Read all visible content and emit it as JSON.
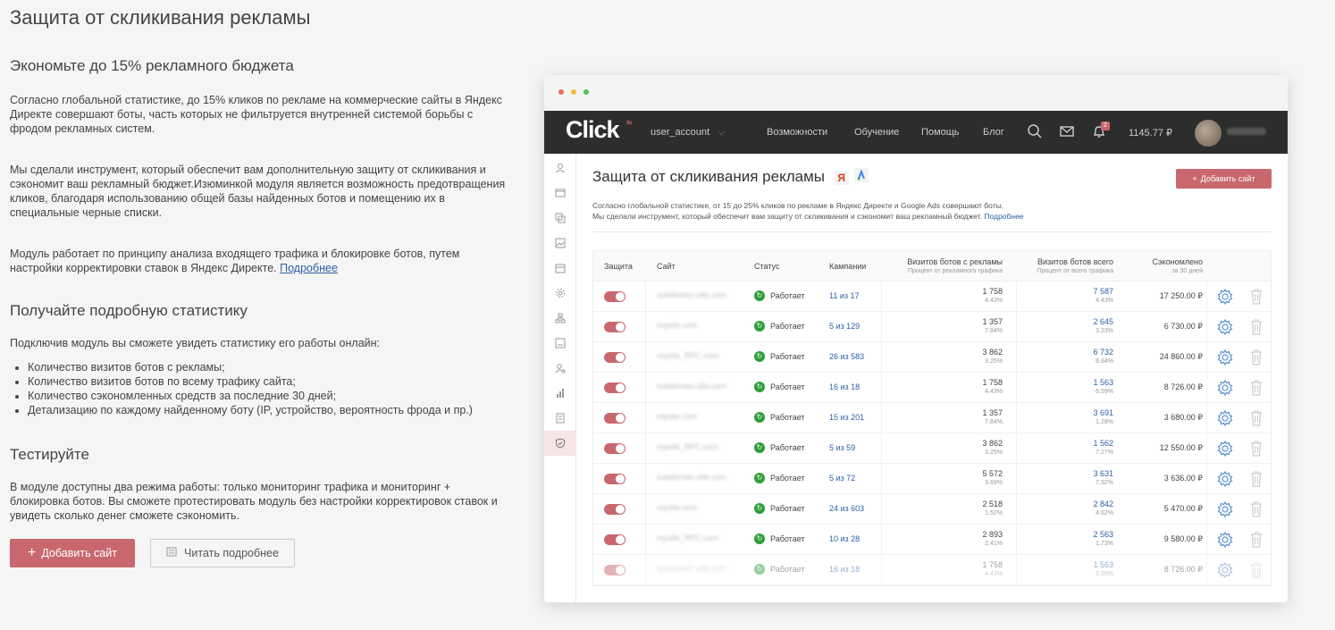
{
  "page": {
    "title": "Защита от скликивания рекламы"
  },
  "section1": {
    "heading": "Экономьте до 15% рекламного бюджета",
    "p1": "Согласно глобальной статистике, до 15% кликов по рекламе на коммерческие сайты в Яндекс Директе совершают боты, часть которых не фильтруется внутренней системой борьбы с фродом рекламных систем.",
    "p2": "Мы сделали инструмент, который обеспечит вам дополнительную защиту от скликивания и сэкономит ваш рекламный бюджет.Изюминкой модуля является возможность предотвращения кликов, благодаря использованию общей базы найденных ботов и помещению их в специальные черные списки.",
    "p3": "Модуль работает по принципу анализа входящего трафика и блокировке ботов, путем настройки корректировки ставок в Яндекс Директе.",
    "p3_link": "Подробнее"
  },
  "section2": {
    "heading": "Получайте подробную статистику",
    "intro": "Подключив модуль вы сможете увидеть статистику его работы онлайн:",
    "items": [
      "Количество визитов ботов с рекламы;",
      "Количество визитов ботов по всему трафику сайта;",
      "Количество сэкономленных средств за последние 30 дней;",
      "Детализацию по каждому найденному боту (IP, устройство, вероятность фрода и пр.)"
    ]
  },
  "section3": {
    "heading": "Тестируйте",
    "text": "В модуле доступны два режима работы: только мониторинг трафика и мониторинг + блокировка ботов. Вы сможете протестировать модуль без настройки корректировок ставок и увидеть сколько денег сможете сэкономить."
  },
  "buttons": {
    "add_site": "Добавить сайт",
    "read_more": "Читать подробнее"
  },
  "mock": {
    "logo": "Click",
    "logo_sup": "ru",
    "account": "user_account",
    "nav": [
      "Возможности",
      "Обучение",
      "Помощь",
      "Блог"
    ],
    "notif_count": "2",
    "balance": "1145.77 ₽",
    "title": "Защита от скликивания рекламы",
    "yandex_badge": "Я",
    "add_button": "Добавить сайт",
    "desc1": "Согласно глобальной статистике, от 15 до 25% кликов по рекламе в Яндекс Директе и Google Ads совершают боты.",
    "desc2": "Мы сделали инструмент, который обеспечит вам защиту от скликивания и сэкономит ваш рекламный бюджет.",
    "desc_link": "Подробнее",
    "headers": {
      "protect": "Защита",
      "site": "Сайт",
      "status": "Статус",
      "campaigns": "Кампании",
      "bots_ads": "Визитов ботов с рекламы",
      "bots_ads_sub": "Процент от рекламного трафика",
      "bots_all": "Визитов ботов всего",
      "bots_all_sub": "Процент от всего трафика",
      "saved": "Сэкономлено",
      "saved_sub": "за 30 дней"
    },
    "rows": [
      {
        "site": "subdomen.site.com",
        "status": "Работает",
        "camp": "11 из 17",
        "v1": "1 758",
        "p1": "4.43%",
        "v2": "7 587",
        "p2": "4.43%",
        "saved": "17 250.00 ₽"
      },
      {
        "site": "mysite.com",
        "status": "Работает",
        "camp": "5 из 129",
        "v1": "1 357",
        "p1": "7.84%",
        "v2": "2 645",
        "p2": "3.23%",
        "saved": "6 730.00 ₽"
      },
      {
        "site": "mysite_RFC.com",
        "status": "Работает",
        "camp": "26 из 583",
        "v1": "3 862",
        "p1": "3.25%",
        "v2": "6 732",
        "p2": "6.84%",
        "saved": "24 860.00 ₽"
      },
      {
        "site": "subdomen.site.com",
        "status": "Работает",
        "camp": "16 из 18",
        "v1": "1 758",
        "p1": "4.43%",
        "v2": "1 563",
        "p2": "6.59%",
        "saved": "8 726.00 ₽"
      },
      {
        "site": "mysite.com",
        "status": "Работает",
        "camp": "15 из 201",
        "v1": "1 357",
        "p1": "7.84%",
        "v2": "3 691",
        "p2": "1.28%",
        "saved": "3 680.00 ₽"
      },
      {
        "site": "mysite_RFC.com",
        "status": "Работает",
        "camp": "5 из 59",
        "v1": "3 862",
        "p1": "3.25%",
        "v2": "1 562",
        "p2": "7.27%",
        "saved": "12 550.00 ₽"
      },
      {
        "site": "subdomen.site.com",
        "status": "Работает",
        "camp": "5 из 72",
        "v1": "5 572",
        "p1": "3.69%",
        "v2": "3 631",
        "p2": "7.92%",
        "saved": "3 636.00 ₽"
      },
      {
        "site": "mysite.com",
        "status": "Работает",
        "camp": "24 из 603",
        "v1": "2 518",
        "p1": "1.52%",
        "v2": "2 842",
        "p2": "4.62%",
        "saved": "5 470.00 ₽"
      },
      {
        "site": "mysite_RFC.com",
        "status": "Работает",
        "camp": "10 из 28",
        "v1": "2 893",
        "p1": "2.41%",
        "v2": "2 563",
        "p2": "1.73%",
        "saved": "9 580.00 ₽"
      },
      {
        "site": "subdomen.site.com",
        "status": "Работает",
        "camp": "16 из 18",
        "v1": "1 758",
        "p1": "4.43%",
        "v2": "1 563",
        "p2": "6.59%",
        "saved": "8 726.00 ₽"
      }
    ]
  },
  "colors": {
    "accent": "#c8686e",
    "link": "#2b5fa8",
    "status_ok": "#2e9d3a",
    "topbar": "#2d2d2d"
  }
}
